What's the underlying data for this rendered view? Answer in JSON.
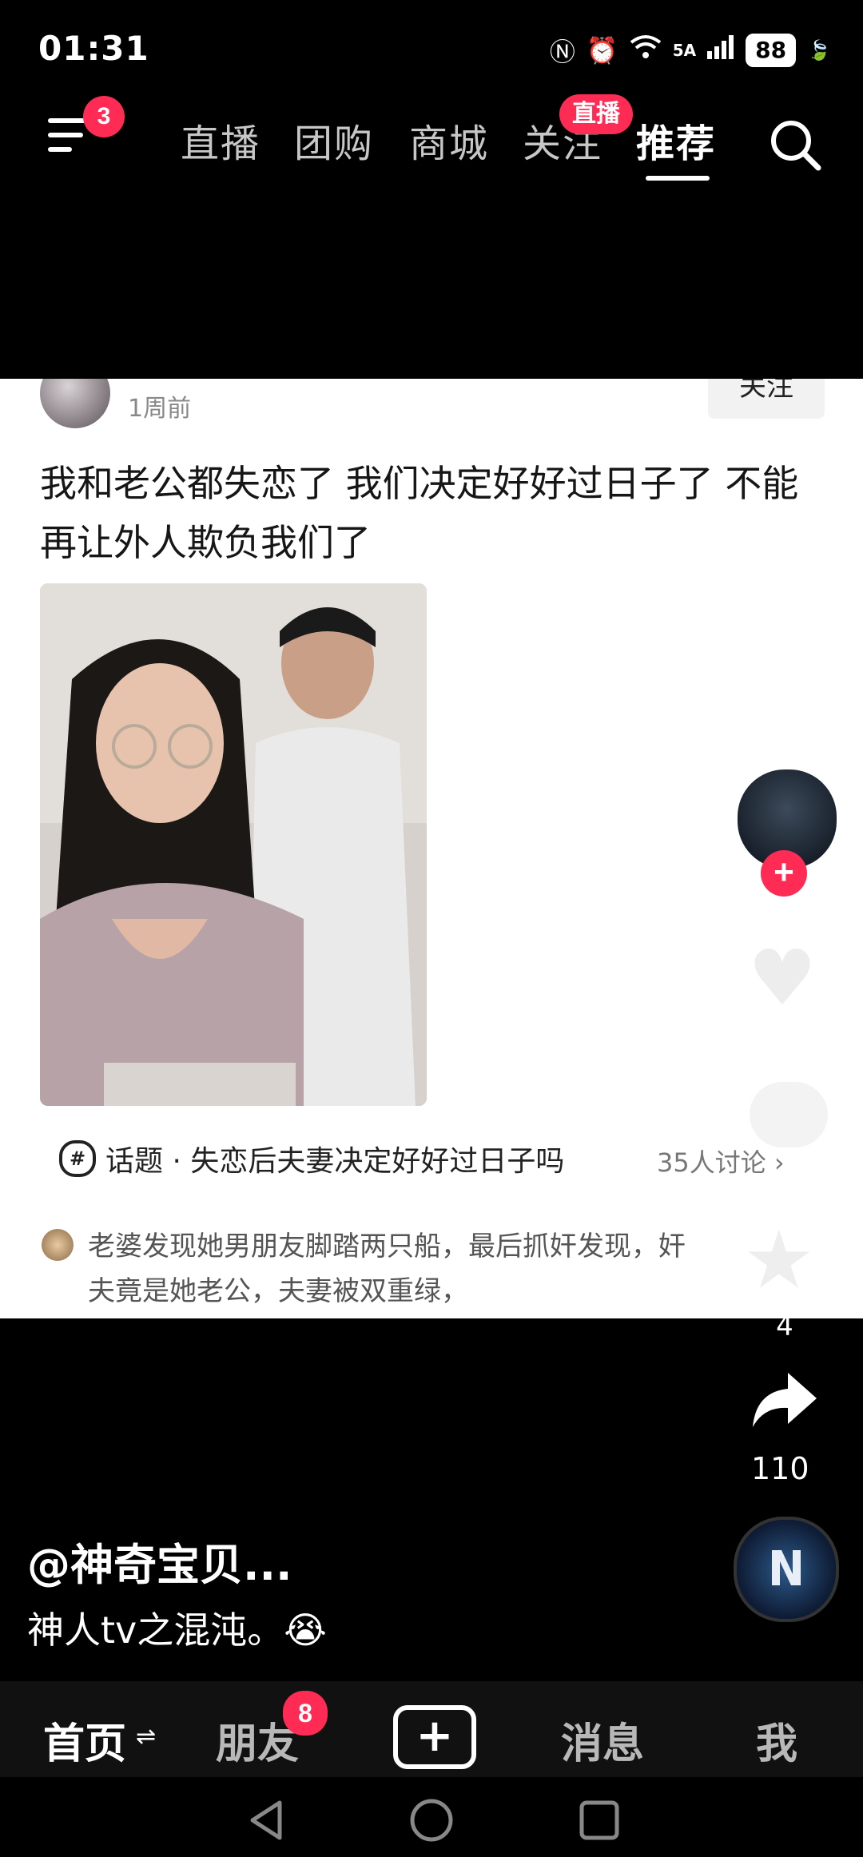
{
  "status_bar": {
    "time": "01:31",
    "network": "5A",
    "battery": "88"
  },
  "top_nav": {
    "menu_badge": "3",
    "tabs": [
      {
        "label": "直播"
      },
      {
        "label": "团购"
      },
      {
        "label": "商城"
      },
      {
        "label": "关注",
        "badge": "直播"
      },
      {
        "label": "推荐",
        "active": true
      }
    ]
  },
  "post": {
    "time": "1周前",
    "follow_label": "关注",
    "text": "我和老公都失恋了 我们决定好好过日子了 不能再让外人欺负我们了",
    "topic_label": "话题 · 失恋后夫妻决定好好过日子吗",
    "topic_count": "35人讨论",
    "comment": "老婆发现她男朋友脚踏两只船，最后抓奸发现，奸夫竟是她老公，夫妻被双重绿，"
  },
  "right_rail": {
    "favorite_count": "4",
    "share_count": "110"
  },
  "caption": {
    "author": "@神奇宝贝...",
    "text": "神人tv之混沌。😭"
  },
  "bottom_nav": {
    "tabs": [
      {
        "label": "首页",
        "active": true
      },
      {
        "label": "朋友",
        "badge": "8"
      },
      {
        "label": "消息"
      },
      {
        "label": "我"
      }
    ]
  },
  "colors": {
    "accent": "#fe2c55",
    "background": "#000000",
    "card": "#ffffff"
  }
}
